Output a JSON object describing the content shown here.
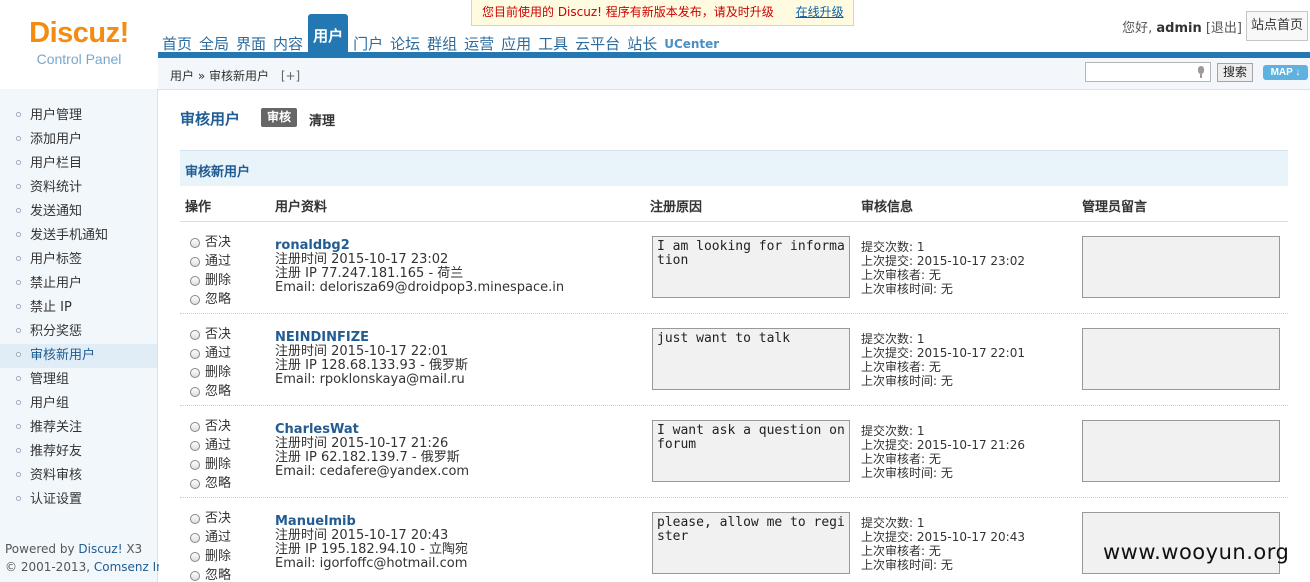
{
  "logo": {
    "name": "Discuz!",
    "sub": "Control Panel"
  },
  "nav": [
    {
      "label": "首页"
    },
    {
      "label": "全局"
    },
    {
      "label": "界面"
    },
    {
      "label": "内容"
    },
    {
      "label": "用户",
      "active": true
    },
    {
      "label": "门户"
    },
    {
      "label": "论坛"
    },
    {
      "label": "群组"
    },
    {
      "label": "运营"
    },
    {
      "label": "应用"
    },
    {
      "label": "工具"
    },
    {
      "label": "云平台"
    },
    {
      "label": "站长"
    },
    {
      "label": "UCenter"
    }
  ],
  "notice": {
    "text": "您目前使用的 Discuz! 程序有新版本发布，请及时升级",
    "link": "在线升级"
  },
  "userbar": {
    "greeting": "您好,",
    "username": "admin",
    "logout": "[退出]",
    "home": "站点首页"
  },
  "breadcrumb": {
    "path": "用户 » 审核新用户",
    "add": "[+]"
  },
  "search": {
    "value": "",
    "button": "搜索"
  },
  "map_button": "MAP ↓",
  "sidebar": {
    "items": [
      "用户管理",
      "添加用户",
      "用户栏目",
      "资料统计",
      "发送通知",
      "发送手机通知",
      "用户标签",
      "禁止用户",
      "禁止 IP",
      "积分奖惩",
      "审核新用户",
      "管理组",
      "用户组",
      "推荐关注",
      "推荐好友",
      "资料审核",
      "认证设置"
    ],
    "active_index": 10,
    "powered_prefix": "Powered by ",
    "powered_brand": "Discuz!",
    "powered_version": " X3",
    "copyright_prefix": "© 2001-2013, ",
    "copyright_brand": "Comsenz Inc."
  },
  "main": {
    "title": "审核用户",
    "tab_audit": "审核",
    "tab_clean": "清理",
    "section": "审核新用户",
    "columns": [
      "操作",
      "用户资料",
      "注册原因",
      "审核信息",
      "管理员留言"
    ]
  },
  "op_labels": [
    "否决",
    "通过",
    "删除",
    "忽略"
  ],
  "rows": [
    {
      "username": "ronaldbg2",
      "reg_time": "注册时间 2015-10-17 23:02",
      "reg_ip": "注册 IP 77.247.181.165 - 荷兰",
      "email": "Email: delorisza69@droidpop3.minespace.in",
      "reason": "I am looking for information",
      "submit_count": "提交次数: 1",
      "last_submit": "上次提交: 2015-10-17 23:02",
      "last_auditor": "上次审核者: 无",
      "last_audit_time": "上次审核时间: 无",
      "note": ""
    },
    {
      "username": "NEINDINFIZE",
      "reg_time": "注册时间 2015-10-17 22:01",
      "reg_ip": "注册 IP 128.68.133.93 - 俄罗斯",
      "email": "Email: rpoklonskaya@mail.ru",
      "reason": "just want to talk",
      "submit_count": "提交次数: 1",
      "last_submit": "上次提交: 2015-10-17 22:01",
      "last_auditor": "上次审核者: 无",
      "last_audit_time": "上次审核时间: 无",
      "note": ""
    },
    {
      "username": "CharlesWat",
      "reg_time": "注册时间 2015-10-17 21:26",
      "reg_ip": "注册 IP 62.182.139.7 - 俄罗斯",
      "email": "Email: cedafere@yandex.com",
      "reason": "I want ask a question on forum",
      "submit_count": "提交次数: 1",
      "last_submit": "上次提交: 2015-10-17 21:26",
      "last_auditor": "上次审核者: 无",
      "last_audit_time": "上次审核时间: 无",
      "note": ""
    },
    {
      "username": "Manuelmib",
      "reg_time": "注册时间 2015-10-17 20:43",
      "reg_ip": "注册 IP 195.182.94.10 - 立陶宛",
      "email": "Email: igorfoffc@hotmail.com",
      "reason": "please, allow me to register",
      "submit_count": "提交次数: 1",
      "last_submit": "上次提交: 2015-10-17 20:43",
      "last_auditor": "上次审核者: 无",
      "last_audit_time": "上次审核时间: 无",
      "note": ""
    }
  ],
  "watermark": "www.wooyun.org"
}
